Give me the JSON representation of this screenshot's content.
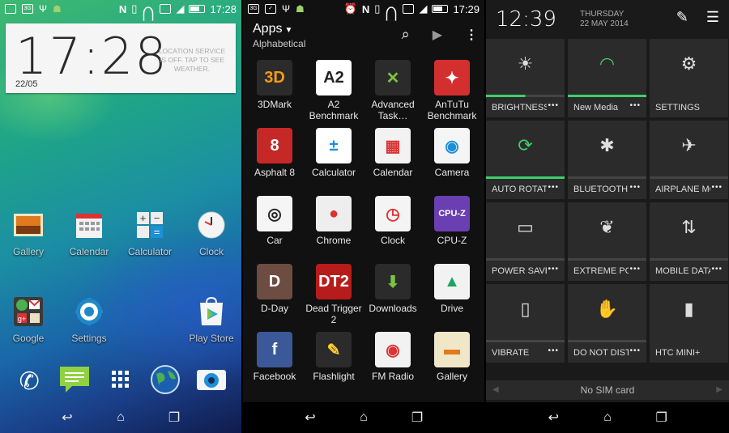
{
  "home": {
    "status": {
      "time": "17:28"
    },
    "clock": {
      "time": "17:28",
      "date": "22/05",
      "weather_message": "LOCATION SERVICE IS OFF. TAP TO SEE WEATHER."
    },
    "icons": [
      {
        "label": "Gallery",
        "icon": "gallery-icon"
      },
      {
        "label": "Calendar",
        "icon": "calendar-icon"
      },
      {
        "label": "Calculator",
        "icon": "calculator-icon"
      },
      {
        "label": "Clock",
        "icon": "clock-icon"
      },
      {
        "label": "Google",
        "icon": "google-folder-icon"
      },
      {
        "label": "Settings",
        "icon": "settings-icon"
      },
      {
        "label": "Play Store",
        "icon": "play-store-icon"
      }
    ],
    "dock": [
      "phone-icon",
      "messages-icon",
      "app-drawer-icon",
      "browser-icon",
      "camera-icon"
    ]
  },
  "apps": {
    "status": {
      "time": "17:29"
    },
    "title": "Apps",
    "sort": "Alphabetical",
    "grid": [
      {
        "label": "3DMark",
        "badge": "3D"
      },
      {
        "label": "A2 Benchmark",
        "badge": "A2"
      },
      {
        "label": "Advanced Task…",
        "badge": "✕"
      },
      {
        "label": "AnTuTu Benchmark",
        "badge": "✦"
      },
      {
        "label": "Asphalt 8",
        "badge": "8"
      },
      {
        "label": "Calculator",
        "badge": "±"
      },
      {
        "label": "Calendar",
        "badge": "▦"
      },
      {
        "label": "Camera",
        "badge": "◉"
      },
      {
        "label": "Car",
        "badge": "◎"
      },
      {
        "label": "Chrome",
        "badge": "●"
      },
      {
        "label": "Clock",
        "badge": "◷"
      },
      {
        "label": "CPU-Z",
        "badge": "CPU-Z"
      },
      {
        "label": "D-Day",
        "badge": "D"
      },
      {
        "label": "Dead Trigger 2",
        "badge": "DT2"
      },
      {
        "label": "Downloads",
        "badge": "⬇"
      },
      {
        "label": "Drive",
        "badge": "▲"
      },
      {
        "label": "Facebook",
        "badge": "f"
      },
      {
        "label": "Flashlight",
        "badge": "✎"
      },
      {
        "label": "FM Radio",
        "badge": "◉"
      },
      {
        "label": "Gallery",
        "badge": "▬"
      }
    ]
  },
  "quick_settings": {
    "time": "12:39",
    "day": "THURSDAY",
    "date": "22 MAY 2014",
    "tiles": [
      {
        "label": "BRIGHTNESS",
        "icon": "☀",
        "state": "half"
      },
      {
        "label": "New Media",
        "icon": "wifi",
        "state": "on"
      },
      {
        "label": "SETTINGS",
        "icon": "⚙",
        "state": "none"
      },
      {
        "label": "AUTO ROTATE",
        "icon": "⟳",
        "state": "on"
      },
      {
        "label": "BLUETOOTH",
        "icon": "✱",
        "state": "off"
      },
      {
        "label": "AIRPLANE MODE",
        "icon": "✈",
        "state": "off"
      },
      {
        "label": "POWER SAVER",
        "icon": "▭",
        "state": "off"
      },
      {
        "label": "EXTREME POWER SAVING",
        "icon": "❦",
        "state": "off"
      },
      {
        "label": "MOBILE DATA",
        "icon": "⇅",
        "state": "off"
      },
      {
        "label": "VIBRATE",
        "icon": "▯",
        "state": "off"
      },
      {
        "label": "DO NOT DISTURB",
        "icon": "✋",
        "state": "off"
      },
      {
        "label": "HTC MINI+",
        "icon": "▮",
        "state": "none"
      }
    ],
    "sim_message": "No SIM card"
  }
}
